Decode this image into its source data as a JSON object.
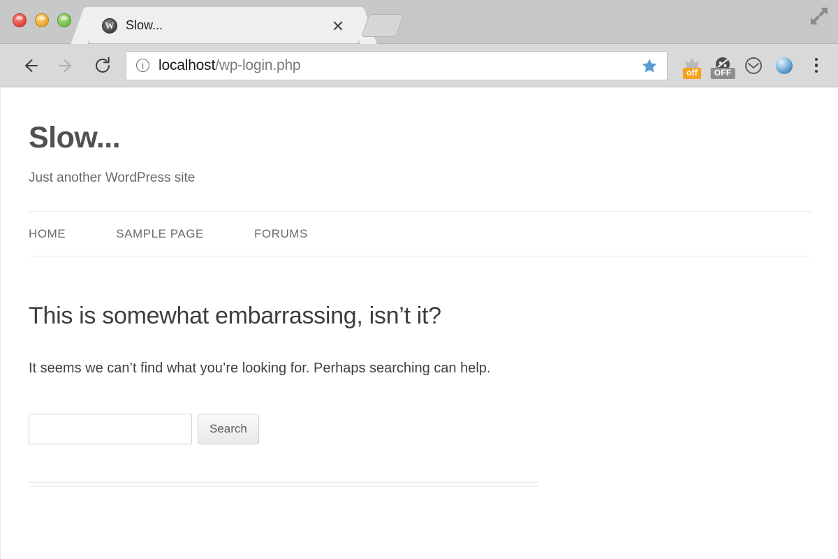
{
  "browser": {
    "window_controls": [
      {
        "name": "close",
        "color": "#e0443a"
      },
      {
        "name": "minimize",
        "color": "#e8a52e"
      },
      {
        "name": "zoom",
        "color": "#72bc4b"
      }
    ],
    "tab": {
      "title": "Slow...",
      "favicon_letter": "W",
      "close_label": "×"
    },
    "newtab_label": "",
    "toolbar": {
      "back_label": "←",
      "forward_label": "→",
      "reload_label": "↻",
      "security_icon_label": "i",
      "url_host": "localhost",
      "url_path": "/wp-login.php",
      "url_full": "localhost/wp-login.php",
      "bookmark_star_color": "#5b9bd5",
      "extensions": [
        {
          "name": "adblock-off",
          "badge": "off",
          "badge_color": "#f5a21e"
        },
        {
          "name": "ghostery-off",
          "badge": "OFF",
          "badge_color": "#8c8c8c"
        },
        {
          "name": "sync-icon",
          "badge": "",
          "badge_color": ""
        },
        {
          "name": "globe-icon",
          "badge": "",
          "badge_color": ""
        }
      ],
      "menu_label": "⋮"
    }
  },
  "page": {
    "site_title": "Slow...",
    "site_description": "Just another WordPress site",
    "nav": [
      {
        "label": "Home"
      },
      {
        "label": "Sample Page"
      },
      {
        "label": "Forums"
      }
    ],
    "content": {
      "heading": "This is somewhat embarrassing, isn’t it?",
      "body": "It seems we can’t find what you’re looking for. Perhaps searching can help.",
      "search": {
        "value": "",
        "placeholder": "",
        "submit_label": "Search"
      }
    }
  }
}
